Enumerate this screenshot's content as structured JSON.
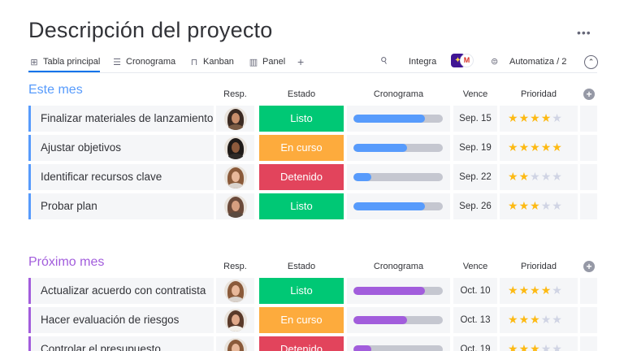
{
  "page": {
    "title": "Descripción del proyecto",
    "more_label": "•••"
  },
  "views": {
    "items": [
      {
        "label": "Tabla principal",
        "icon": "table-icon",
        "glyph": "⊞",
        "active": true
      },
      {
        "label": "Cronograma",
        "icon": "timeline-icon",
        "glyph": "☰",
        "active": false
      },
      {
        "label": "Kanban",
        "icon": "kanban-icon",
        "glyph": "⊓",
        "active": false
      },
      {
        "label": "Panel",
        "icon": "dashboard-icon",
        "glyph": "▥",
        "active": false
      }
    ],
    "add_label": "+",
    "integrate_label": "Integra",
    "app_a": "✦",
    "app_b": "M",
    "automate_label": "Automatiza / 2",
    "collapse_label": "⌃"
  },
  "columns": {
    "person": "Resp.",
    "status": "Estado",
    "timeline": "Cronograma",
    "due": "Vence",
    "priority": "Prioridad"
  },
  "colors": {
    "group_1": "#579bfc",
    "group_2": "#a25ddc",
    "status_listo": "#00c875",
    "status_en_curso": "#fdab3d",
    "status_detenido": "#e2445c",
    "star_on": "#fdba14",
    "star_off": "#d0d4e4"
  },
  "groups": [
    {
      "title": "Este mes",
      "color": "#579bfc",
      "rows": [
        {
          "task": "Finalizar materiales de lanzamiento",
          "status": "Listo",
          "status_color": "#00c875",
          "progress": 0.8,
          "due": "Sep. 15",
          "rating": 4,
          "avatar": {
            "hair": "#3b2a22",
            "skin": "#c98e6b",
            "shirt": "#7a5b44"
          }
        },
        {
          "task": "Ajustar objetivos",
          "status": "En curso",
          "status_color": "#fdab3d",
          "progress": 0.6,
          "due": "Sep. 19",
          "rating": 5,
          "avatar": {
            "hair": "#1f1a18",
            "skin": "#8d5a3c",
            "shirt": "#2e2a28"
          }
        },
        {
          "task": "Identificar recursos clave",
          "status": "Detenido",
          "status_color": "#e2445c",
          "progress": 0.2,
          "due": "Sep. 22",
          "rating": 2,
          "avatar": {
            "hair": "#8a5a3a",
            "skin": "#e8b89a",
            "shirt": "#d9d2cc"
          }
        },
        {
          "task": "Probar plan",
          "status": "Listo",
          "status_color": "#00c875",
          "progress": 0.8,
          "due": "Sep. 26",
          "rating": 3,
          "avatar": {
            "hair": "#6b4a3a",
            "skin": "#d79f80",
            "shirt": "#5a4a40"
          }
        }
      ]
    },
    {
      "title": "Próximo mes",
      "color": "#a25ddc",
      "rows": [
        {
          "task": "Actualizar acuerdo con contratista",
          "status": "Listo",
          "status_color": "#00c875",
          "progress": 0.8,
          "due": "Oct. 10",
          "rating": 4,
          "avatar": {
            "hair": "#8a5a3a",
            "skin": "#e8b89a",
            "shirt": "#d9d2cc"
          }
        },
        {
          "task": "Hacer evaluación de riesgos",
          "status": "En curso",
          "status_color": "#fdab3d",
          "progress": 0.6,
          "due": "Oct. 13",
          "rating": 3,
          "avatar": {
            "hair": "#5a3a2a",
            "skin": "#e0a98a",
            "shirt": "#f2efe9"
          }
        },
        {
          "task": "Controlar el presupuesto",
          "status": "Detenido",
          "status_color": "#e2445c",
          "progress": 0.2,
          "due": "Oct. 19",
          "rating": 3,
          "avatar": {
            "hair": "#8a5a3a",
            "skin": "#e8b89a",
            "shirt": "#d9d2cc"
          }
        }
      ]
    }
  ]
}
